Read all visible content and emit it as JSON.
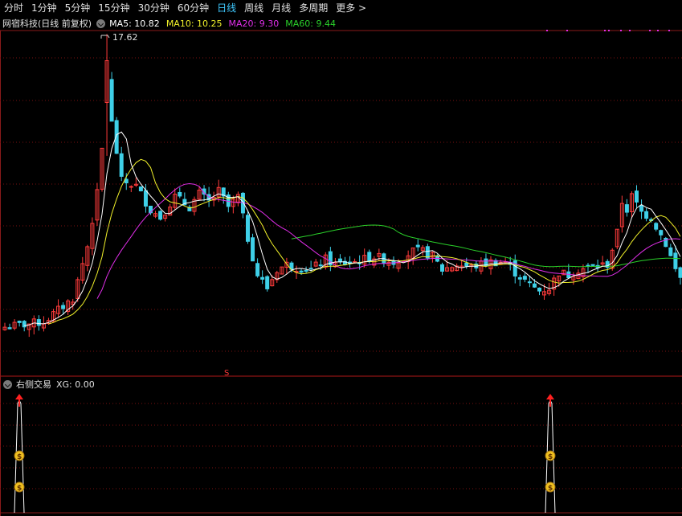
{
  "tabs": [
    {
      "label": "分时",
      "active": false
    },
    {
      "label": "1分钟",
      "active": false
    },
    {
      "label": "5分钟",
      "active": false
    },
    {
      "label": "15分钟",
      "active": false
    },
    {
      "label": "30分钟",
      "active": false
    },
    {
      "label": "60分钟",
      "active": false
    },
    {
      "label": "日线",
      "active": true
    },
    {
      "label": "周线",
      "active": false
    },
    {
      "label": "月线",
      "active": false
    },
    {
      "label": "多周期",
      "active": false
    },
    {
      "label": "更多 >",
      "active": false
    }
  ],
  "main_legend": {
    "name": "网宿科技(日线 前复权)",
    "ma5": "MA5: 10.82",
    "ma10": "MA10: 10.25",
    "ma20": "MA20: 9.30",
    "ma60": "MA60: 9.44"
  },
  "high_label": "17.62",
  "signal_marker": "S",
  "lower_legend": {
    "name": "右侧交易",
    "xg": "XG: 0.00"
  },
  "colors": {
    "up": "#ff3b3b",
    "down": "#3fd0e8",
    "ma5": "#ffffff",
    "ma10": "#f0f02a",
    "ma20": "#e02ee8",
    "ma60": "#2ad02a",
    "active_tab": "#3fc9ff",
    "grid": "#7a1010"
  },
  "chart_data": {
    "type": "candlestick",
    "high_value": 17.62,
    "ma_series": [
      {
        "name": "MA5",
        "value": 10.82
      },
      {
        "name": "MA10",
        "value": 10.25
      },
      {
        "name": "MA20",
        "value": 9.3
      },
      {
        "name": "MA60",
        "value": 9.44
      }
    ],
    "xg_value": 0.0,
    "signal_days": [
      3,
      98
    ]
  }
}
